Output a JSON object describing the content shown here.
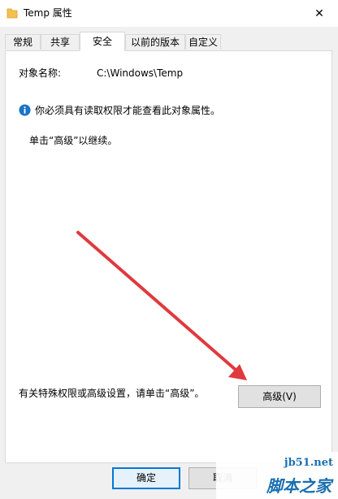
{
  "window": {
    "title": "Temp 属性",
    "close_glyph": "✕"
  },
  "tabs": [
    {
      "label": "常规",
      "active": false
    },
    {
      "label": "共享",
      "active": false
    },
    {
      "label": "安全",
      "active": true
    },
    {
      "label": "以前的版本",
      "active": false
    },
    {
      "label": "自定义",
      "active": false
    }
  ],
  "security": {
    "object_name_label": "对象名称:",
    "object_name_value": "C:\\Windows\\Temp",
    "info_message": "你必须具有读取权限才能查看此对象属性。",
    "continue_hint": "单击“高级”以继续。",
    "advanced_hint": "有关特殊权限或高级设置，请单击“高级”。",
    "advanced_button": "高级(V)"
  },
  "footer": {
    "ok_label": "确定",
    "cancel_label": "取消"
  },
  "watermark": {
    "site": "jb51.net",
    "name": "脚本之家"
  },
  "colors": {
    "accent": "#0078d7",
    "info_icon": "#1a73c6",
    "arrow": "#e0393e",
    "folder": "#f2c14e"
  }
}
